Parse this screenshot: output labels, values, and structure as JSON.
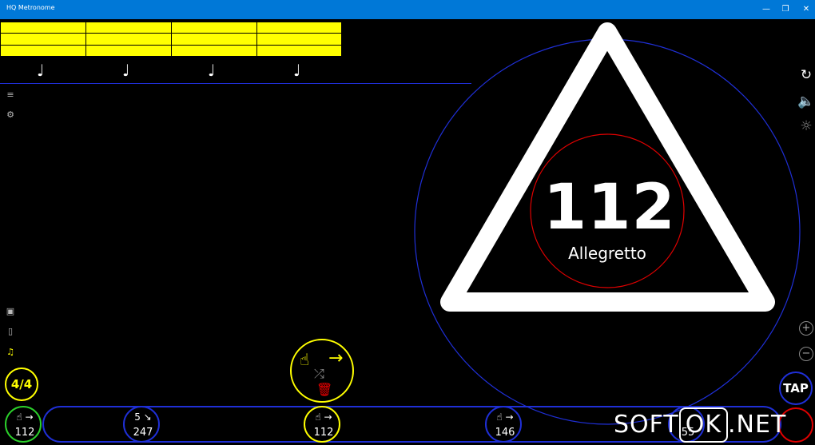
{
  "window": {
    "title": "HQ Metronome",
    "minimize": "—",
    "maximize": "❐",
    "close": "✕"
  },
  "beats": {
    "notes": [
      "♩",
      "♩",
      "♩",
      "♩"
    ]
  },
  "left_icons": {
    "menu": "≡",
    "settings": "⚙",
    "save": "▣",
    "page": "▯",
    "music": "♫"
  },
  "right_icons": {
    "reset": "↻",
    "sound": "🔈",
    "brightness": "☼"
  },
  "tempo": {
    "bpm": "112",
    "name": "Allegretto"
  },
  "controls": {
    "time_signature": "4/4",
    "tap": "TAP",
    "plus": "+",
    "minus": "−"
  },
  "editor": {
    "hand": "☝",
    "arrow": "→",
    "shuffle": "⤮",
    "trash": "🗑"
  },
  "steps": [
    {
      "top": "☝ →",
      "value": "112",
      "color": "#2bd12b"
    },
    {
      "top": "5 ↘",
      "value": "247",
      "color": "#1f2fd6"
    },
    {
      "top": "☝ →",
      "value": "112",
      "color": "#ffff00"
    },
    {
      "top": "☝ →",
      "value": "146",
      "color": "#1f2fd6"
    },
    {
      "top": "",
      "value": "55",
      "color": "#1f2fd6"
    },
    {
      "top": "",
      "value": "",
      "color": "#e00000"
    }
  ],
  "watermark": {
    "left": "SOFT",
    "box": "OK",
    "right": ".NET"
  },
  "colors": {
    "accent": "#ffff00",
    "blue": "#1f2fd6",
    "red": "#e00000",
    "titlebar": "#0078d7"
  }
}
